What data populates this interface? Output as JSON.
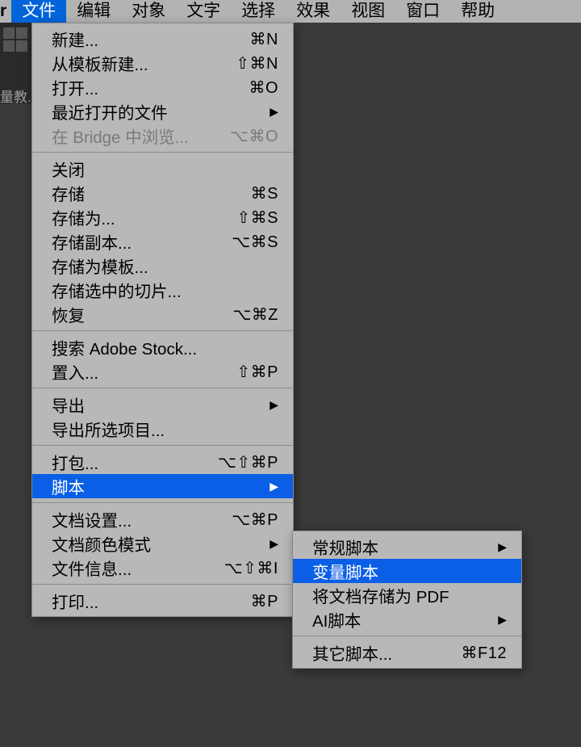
{
  "menubar": {
    "app": "r",
    "items": [
      "文件",
      "编辑",
      "对象",
      "文字",
      "选择",
      "效果",
      "视图",
      "窗口",
      "帮助"
    ],
    "active_index": 0
  },
  "sidebar_hint": "量教.",
  "file_menu": [
    {
      "type": "item",
      "label": "新建...",
      "shortcut": "⌘N"
    },
    {
      "type": "item",
      "label": "从模板新建...",
      "shortcut": "⇧⌘N"
    },
    {
      "type": "item",
      "label": "打开...",
      "shortcut": "⌘O"
    },
    {
      "type": "item",
      "label": "最近打开的文件",
      "submenu": true
    },
    {
      "type": "item",
      "label": "在 Bridge 中浏览...",
      "shortcut": "⌥⌘O",
      "disabled": true
    },
    {
      "type": "separator"
    },
    {
      "type": "item",
      "label": "关闭",
      "shortcut": ""
    },
    {
      "type": "item",
      "label": "存储",
      "shortcut": "⌘S"
    },
    {
      "type": "item",
      "label": "存储为...",
      "shortcut": "⇧⌘S"
    },
    {
      "type": "item",
      "label": "存储副本...",
      "shortcut": "⌥⌘S"
    },
    {
      "type": "item",
      "label": "存储为模板...",
      "shortcut": ""
    },
    {
      "type": "item",
      "label": "存储选中的切片...",
      "shortcut": ""
    },
    {
      "type": "item",
      "label": "恢复",
      "shortcut": "⌥⌘Z"
    },
    {
      "type": "separator"
    },
    {
      "type": "item",
      "label": "搜索 Adobe Stock...",
      "shortcut": ""
    },
    {
      "type": "item",
      "label": "置入...",
      "shortcut": "⇧⌘P"
    },
    {
      "type": "separator"
    },
    {
      "type": "item",
      "label": "导出",
      "submenu": true
    },
    {
      "type": "item",
      "label": "导出所选项目...",
      "shortcut": ""
    },
    {
      "type": "separator"
    },
    {
      "type": "item",
      "label": "打包...",
      "shortcut": "⌥⇧⌘P"
    },
    {
      "type": "item",
      "label": "脚本",
      "submenu": true,
      "highlighted": true
    },
    {
      "type": "separator"
    },
    {
      "type": "item",
      "label": "文档设置...",
      "shortcut": "⌥⌘P"
    },
    {
      "type": "item",
      "label": "文档颜色模式",
      "submenu": true
    },
    {
      "type": "item",
      "label": "文件信息...",
      "shortcut": "⌥⇧⌘I"
    },
    {
      "type": "separator"
    },
    {
      "type": "item",
      "label": "打印...",
      "shortcut": "⌘P"
    }
  ],
  "script_submenu": [
    {
      "type": "item",
      "label": "常规脚本",
      "submenu": true
    },
    {
      "type": "item",
      "label": "变量脚本",
      "highlighted": true
    },
    {
      "type": "item",
      "label": "将文档存储为 PDF",
      "shortcut": ""
    },
    {
      "type": "item",
      "label": "AI脚本",
      "submenu": true
    },
    {
      "type": "separator"
    },
    {
      "type": "item",
      "label": "其它脚本...",
      "shortcut": "⌘F12"
    }
  ]
}
